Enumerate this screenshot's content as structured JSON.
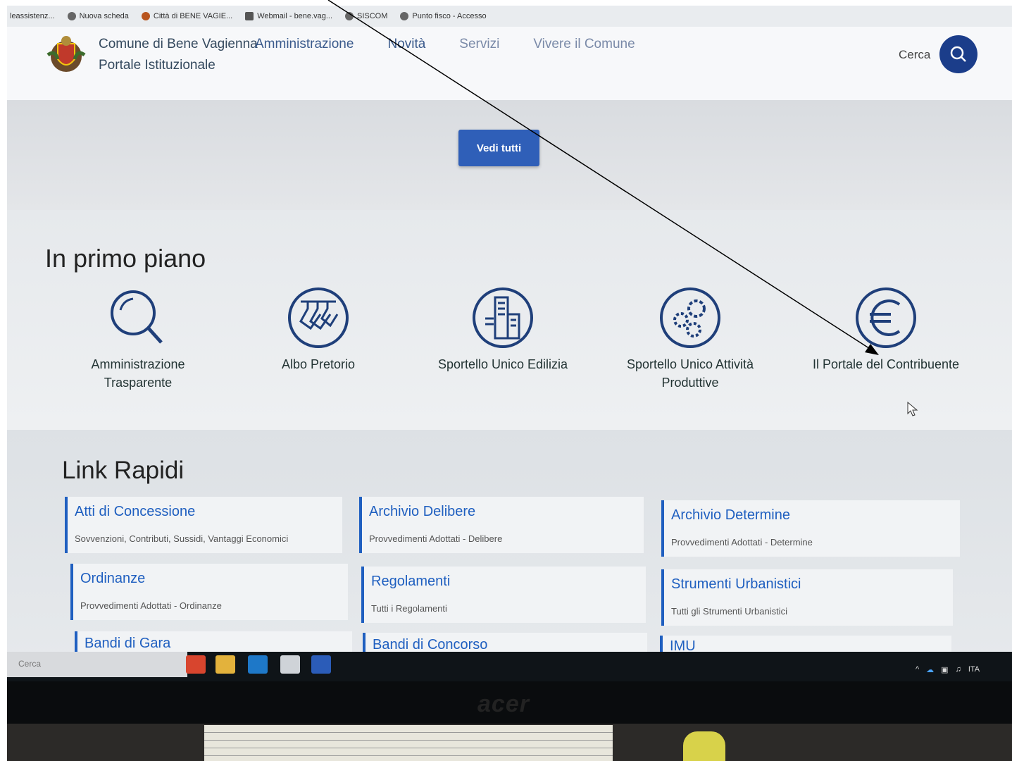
{
  "bookmarks": [
    {
      "label": "leassistenz...",
      "icon": "page-icon"
    },
    {
      "label": "Nuova scheda",
      "icon": "globe-icon"
    },
    {
      "label": "Città di BENE VAGIE...",
      "icon": "crest-icon"
    },
    {
      "label": "Webmail - bene.vag...",
      "icon": "mail-icon"
    },
    {
      "label": "SISCOM",
      "icon": "siscom-icon"
    },
    {
      "label": "Punto fisco - Accesso",
      "icon": "globe-icon"
    }
  ],
  "header": {
    "title_line1": "Comune di Bene Vagienna",
    "title_line2": "Portale Istituzionale",
    "nav": [
      "Amministrazione",
      "Novità",
      "Servizi",
      "Vivere il Comune"
    ],
    "search_label": "Cerca"
  },
  "vedi_tutti": "Vedi tutti",
  "primo_piano": {
    "title": "In primo piano",
    "items": [
      {
        "label": "Amministrazione Trasparente",
        "icon": "magnifier-icon"
      },
      {
        "label": "Albo Pretorio",
        "icon": "hangers-icon"
      },
      {
        "label": "Sportello Unico Edilizia",
        "icon": "buildings-icon"
      },
      {
        "label": "Sportello Unico Attività Produttive",
        "icon": "gears-icon"
      },
      {
        "label": "Il Portale del Contribuente",
        "icon": "euro-icon"
      }
    ]
  },
  "link_rapidi": {
    "title": "Link Rapidi",
    "cards": [
      {
        "title": "Atti di Concessione",
        "subtitle": "Sovvenzioni, Contributi, Sussidi, Vantaggi Economici"
      },
      {
        "title": "Archivio Delibere",
        "subtitle": "Provvedimenti Adottati - Delibere"
      },
      {
        "title": "Archivio Determine",
        "subtitle": "Provvedimenti Adottati - Determine"
      },
      {
        "title": "Ordinanze",
        "subtitle": "Provvedimenti Adottati - Ordinanze"
      },
      {
        "title": "Regolamenti",
        "subtitle": "Tutti i Regolamenti"
      },
      {
        "title": "Strumenti Urbanistici",
        "subtitle": "Tutti gli Strumenti Urbanistici"
      },
      {
        "title": "Bandi di Gara",
        "subtitle": ""
      },
      {
        "title": "Bandi di Concorso",
        "subtitle": ""
      },
      {
        "title": "IMU",
        "subtitle": ""
      }
    ]
  },
  "taskbar": {
    "search": "Cerca",
    "lang": "ITA"
  },
  "monitor_brand": "acer"
}
